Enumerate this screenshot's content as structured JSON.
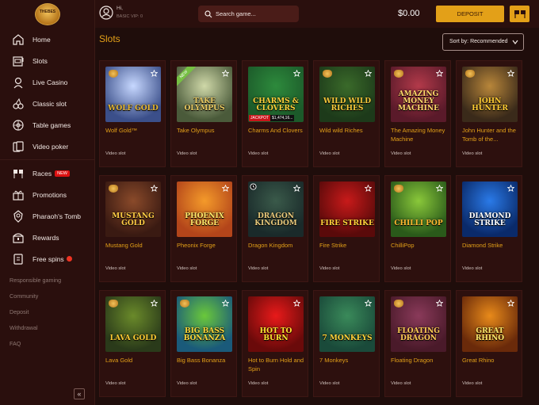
{
  "brand": {
    "logo_text": "THEBES"
  },
  "nav": [
    {
      "label": "Home",
      "icon": "home-icon"
    },
    {
      "label": "Slots",
      "icon": "slot-machine-icon"
    },
    {
      "label": "Live Casino",
      "icon": "dealer-icon"
    },
    {
      "label": "Classic slot",
      "icon": "cherries-icon"
    },
    {
      "label": "Table games",
      "icon": "roulette-icon"
    },
    {
      "label": "Video poker",
      "icon": "cards-icon"
    }
  ],
  "nav2": [
    {
      "label": "Races",
      "icon": "race-flags-icon",
      "badge": "NEW"
    },
    {
      "label": "Promotions",
      "icon": "gift-icon"
    },
    {
      "label": "Pharaoh's Tomb",
      "icon": "pharaoh-icon"
    },
    {
      "label": "Rewards",
      "icon": "chest-icon"
    },
    {
      "label": "Free spins",
      "icon": "free-spins-icon"
    }
  ],
  "sub_links": [
    "Responsible gaming",
    "Community",
    "Deposit",
    "Withdrawal",
    "FAQ"
  ],
  "header": {
    "greeting": "Hi,",
    "vip": "BASIC VIP: 0",
    "search_placeholder": "Search game...",
    "balance": "$0.00",
    "deposit_label": "DEPOSIT"
  },
  "main": {
    "title": "Slots",
    "sort_label": "Sort by: Recommended"
  },
  "colors": {
    "accent": "#e3a018",
    "bg": "#1f0d0b",
    "panel": "#2a0f0d",
    "card": "#2d100e"
  },
  "games": [
    {
      "name": "Wolf Gold™",
      "type": "Video slot",
      "art": "WOLF GOLD"
    },
    {
      "name": "Take Olympus",
      "type": "Video slot",
      "art": "TAKE OLYMPUS",
      "new": "NEW"
    },
    {
      "name": "Charms And Clovers",
      "type": "Video slot",
      "art": "CHARMS & CLOVERS",
      "jackpot": "JACKPOT",
      "jackpot_value": "$1,474,16..."
    },
    {
      "name": "Wild wild Riches",
      "type": "Video slot",
      "art": "WILD WILD RICHES"
    },
    {
      "name": "The Amazing Money Machine",
      "type": "Video slot",
      "art": "AMAZING MONEY MACHINE"
    },
    {
      "name": "John Hunter and the Tomb of the...",
      "type": "Video slot",
      "art": "JOHN HUNTER"
    },
    {
      "name": "Mustang Gold",
      "type": "Video slot",
      "art": "MUSTANG GOLD"
    },
    {
      "name": "Pheonix Forge",
      "type": "Video slot",
      "art": "PHOENIX FORGE"
    },
    {
      "name": "Dragon Kingdom",
      "type": "Video slot",
      "art": "DRAGON KINGDOM"
    },
    {
      "name": "Fire Strike",
      "type": "Video slot",
      "art": "FIRE STRIKE"
    },
    {
      "name": "ChilliPop",
      "type": "Video slot",
      "art": "CHILLI POP"
    },
    {
      "name": "Diamond Strike",
      "type": "Video slot",
      "art": "DIAMOND STRIKE"
    },
    {
      "name": "Lava Gold",
      "type": "Video slot",
      "art": "LAVA GOLD"
    },
    {
      "name": "Big Bass Bonanza",
      "type": "Video slot",
      "art": "BIG BASS BONANZA"
    },
    {
      "name": "Hot to Burn Hold and Spin",
      "type": "Video slot",
      "art": "HOT TO BURN"
    },
    {
      "name": "7 Monkeys",
      "type": "Video slot",
      "art": "7 MONKEYS"
    },
    {
      "name": "Floating Dragon",
      "type": "Video slot",
      "art": "FLOATING DRAGON"
    },
    {
      "name": "Great Rhino",
      "type": "Video slot",
      "art": "GREAT RHINO"
    }
  ]
}
